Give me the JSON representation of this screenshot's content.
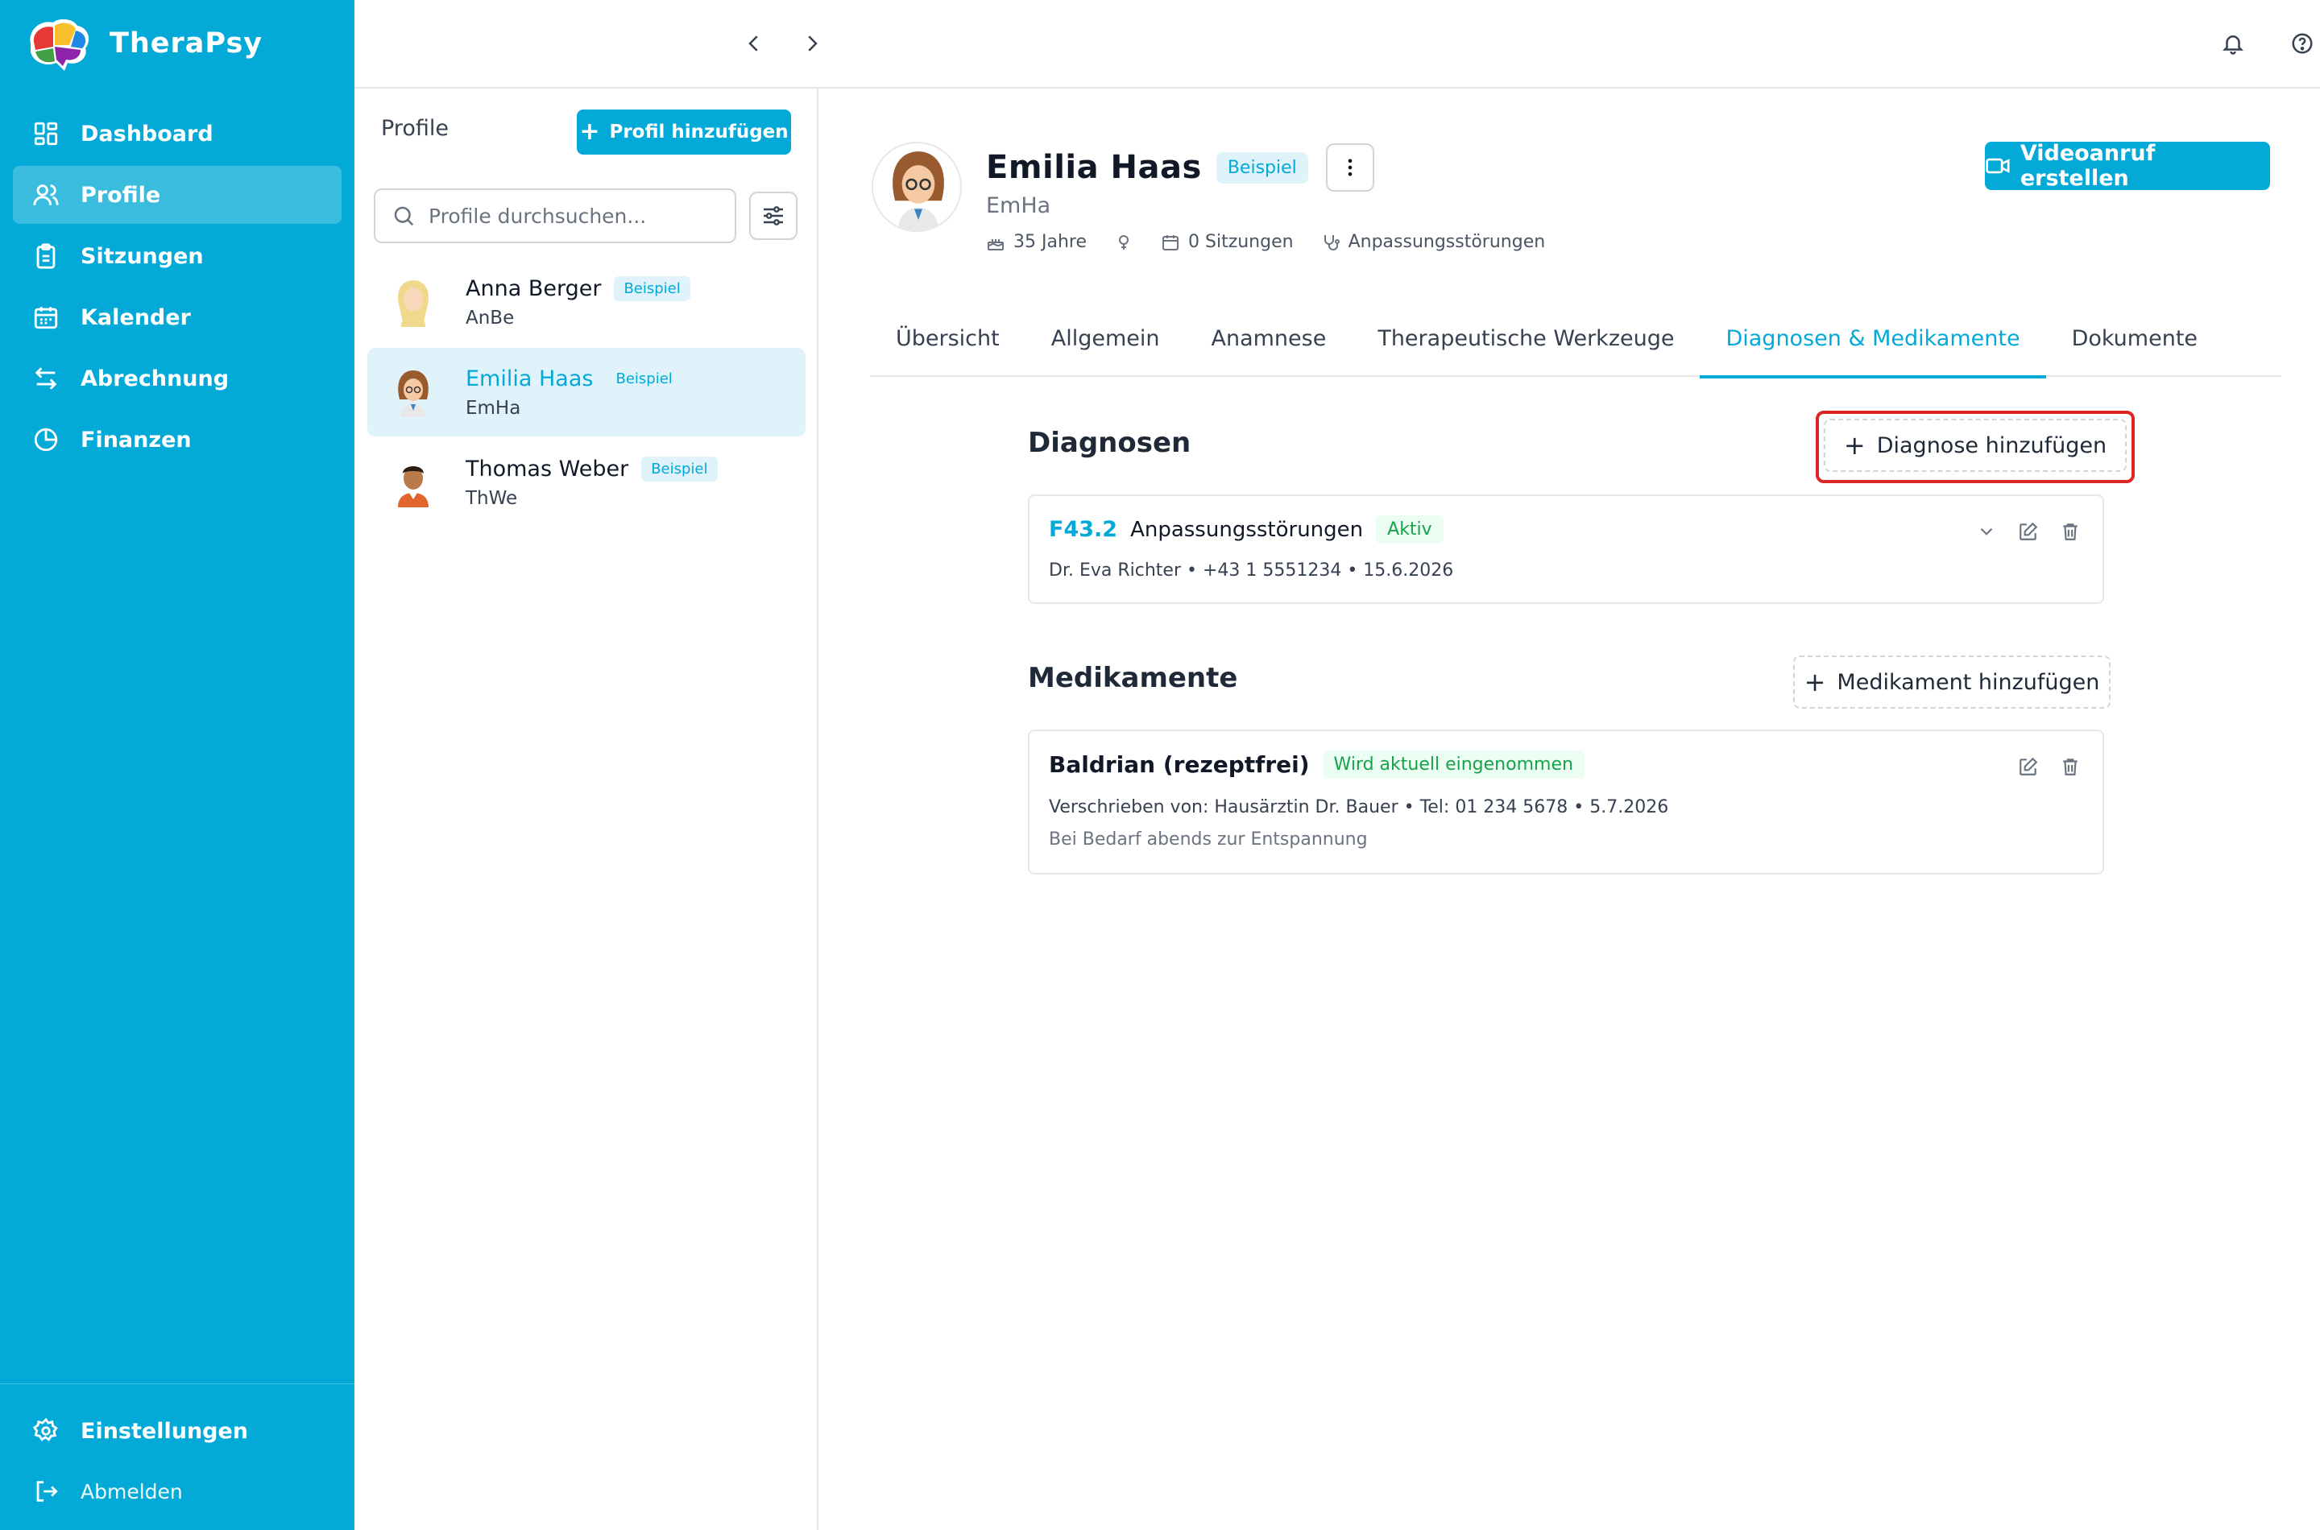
{
  "app": {
    "name": "TheraPsy"
  },
  "sidebar": {
    "items": [
      {
        "label": "Dashboard",
        "icon": "dashboard-icon"
      },
      {
        "label": "Profile",
        "icon": "users-icon"
      },
      {
        "label": "Sitzungen",
        "icon": "clipboard-icon"
      },
      {
        "label": "Kalender",
        "icon": "calendar-icon"
      },
      {
        "label": "Abrechnung",
        "icon": "arrows-icon"
      },
      {
        "label": "Finanzen",
        "icon": "pie-chart-icon"
      }
    ],
    "active_item": "Profile",
    "settings_label": "Einstellungen",
    "logout_label": "Abmelden"
  },
  "profiles_panel": {
    "title": "Profile",
    "add_button": "Profil hinzufügen",
    "search_placeholder": "Profile durchsuchen...",
    "items": [
      {
        "name": "Anna Berger",
        "initials": "AnBe",
        "badge": "Beispiel"
      },
      {
        "name": "Emilia Haas",
        "initials": "EmHa",
        "badge": "Beispiel",
        "selected": true
      },
      {
        "name": "Thomas Weber",
        "initials": "ThWe",
        "badge": "Beispiel"
      }
    ]
  },
  "profile_detail": {
    "name": "Emilia Haas",
    "badge": "Beispiel",
    "initials": "EmHa",
    "age": "35 Jahre",
    "sessions": "0 Sitzungen",
    "diagnosis_summary": "Anpassungsstörungen",
    "video_button": "Videoanruf erstellen",
    "tabs": [
      "Übersicht",
      "Allgemein",
      "Anamnese",
      "Therapeutische Werkzeuge",
      "Diagnosen & Medikamente",
      "Dokumente"
    ],
    "active_tab": "Diagnosen & Medikamente"
  },
  "diagnoses": {
    "title": "Diagnosen",
    "add_button": "Diagnose hinzufügen",
    "items": [
      {
        "code": "F43.2",
        "name": "Anpassungsstörungen",
        "status": "Aktiv",
        "details": "Dr. Eva Richter • +43 1 5551234 • 15.6.2026"
      }
    ]
  },
  "medications": {
    "title": "Medikamente",
    "add_button": "Medikament hinzufügen",
    "items": [
      {
        "name": "Baldrian (rezeptfrei)",
        "status": "Wird aktuell eingenommen",
        "details": "Verschrieben von: Hausärztin Dr. Bauer • Tel: 01 234 5678 • 5.7.2026",
        "note": "Bei Bedarf abends zur Entspannung"
      }
    ]
  },
  "colors": {
    "accent": "#03a9d7",
    "highlight": "#dc2626",
    "status_green": "#16a34a"
  }
}
